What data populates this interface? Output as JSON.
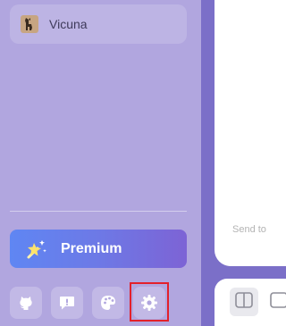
{
  "sidebar": {
    "profile": {
      "name": "Vicuna",
      "icon": "vicuna-avatar-icon"
    },
    "premium": {
      "label": "Premium",
      "icon": "magic-wand-icon"
    },
    "toolbar": [
      {
        "name": "github-button",
        "icon": "github-icon"
      },
      {
        "name": "feedback-button",
        "icon": "feedback-icon"
      },
      {
        "name": "theme-button",
        "icon": "palette-icon"
      },
      {
        "name": "settings-button",
        "icon": "gear-icon"
      }
    ]
  },
  "main": {
    "send_hint": "Send to"
  },
  "colors": {
    "sidebar_bg": "#b1a6df",
    "app_bg": "#7b6fc8",
    "premium_gradient_start": "#5f86f3",
    "premium_gradient_end": "#7d63d5",
    "highlight": "#e3202a"
  }
}
